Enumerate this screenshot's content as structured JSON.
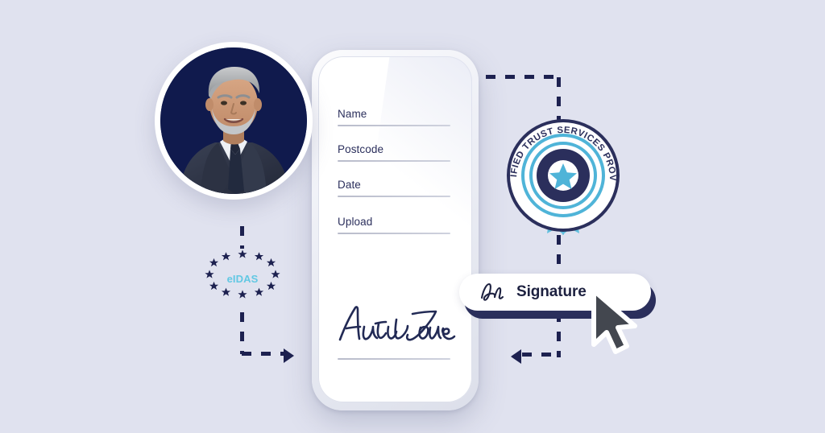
{
  "background_color": "#e0e2ef",
  "accent_navy": "#1d2150",
  "accent_light_blue": "#62c8e3",
  "phone": {
    "name": "mobile-phone-mockup",
    "form": {
      "fields": [
        {
          "label": "Name"
        },
        {
          "label": "Postcode"
        },
        {
          "label": "Date"
        },
        {
          "label": "Upload"
        }
      ]
    },
    "signature": {
      "name": "Anita Jones",
      "icon": "handwritten-signature"
    }
  },
  "portrait": {
    "alt": "smiling businessman in dark suit with grey hair and beard",
    "background_color": "#101a4d"
  },
  "eidas": {
    "label": "eIDAS",
    "star_count": 12,
    "star_color": "#1d2150",
    "label_color": "#62c8e3"
  },
  "badge": {
    "ring_text": "QUALIFIED TRUST SERVICES PROVIDER",
    "center_icon": "star-icon",
    "ribbon_color": "#62c0de",
    "ring_color": "#2b2f5c",
    "arc_color": "#4fb4d8"
  },
  "signature_button": {
    "label": "Signature",
    "icon": "signature-squiggle-icon",
    "shadow_color": "#2b2f5c"
  },
  "cursor": {
    "icon": "mouse-pointer-icon"
  },
  "connectors": [
    {
      "name": "phone-to-badge",
      "direction": "right-then-down"
    },
    {
      "name": "badge-to-button",
      "direction": "down-then-left"
    },
    {
      "name": "portrait-to-eidas",
      "direction": "down"
    },
    {
      "name": "eidas-to-phone",
      "direction": "down-then-right"
    }
  ]
}
